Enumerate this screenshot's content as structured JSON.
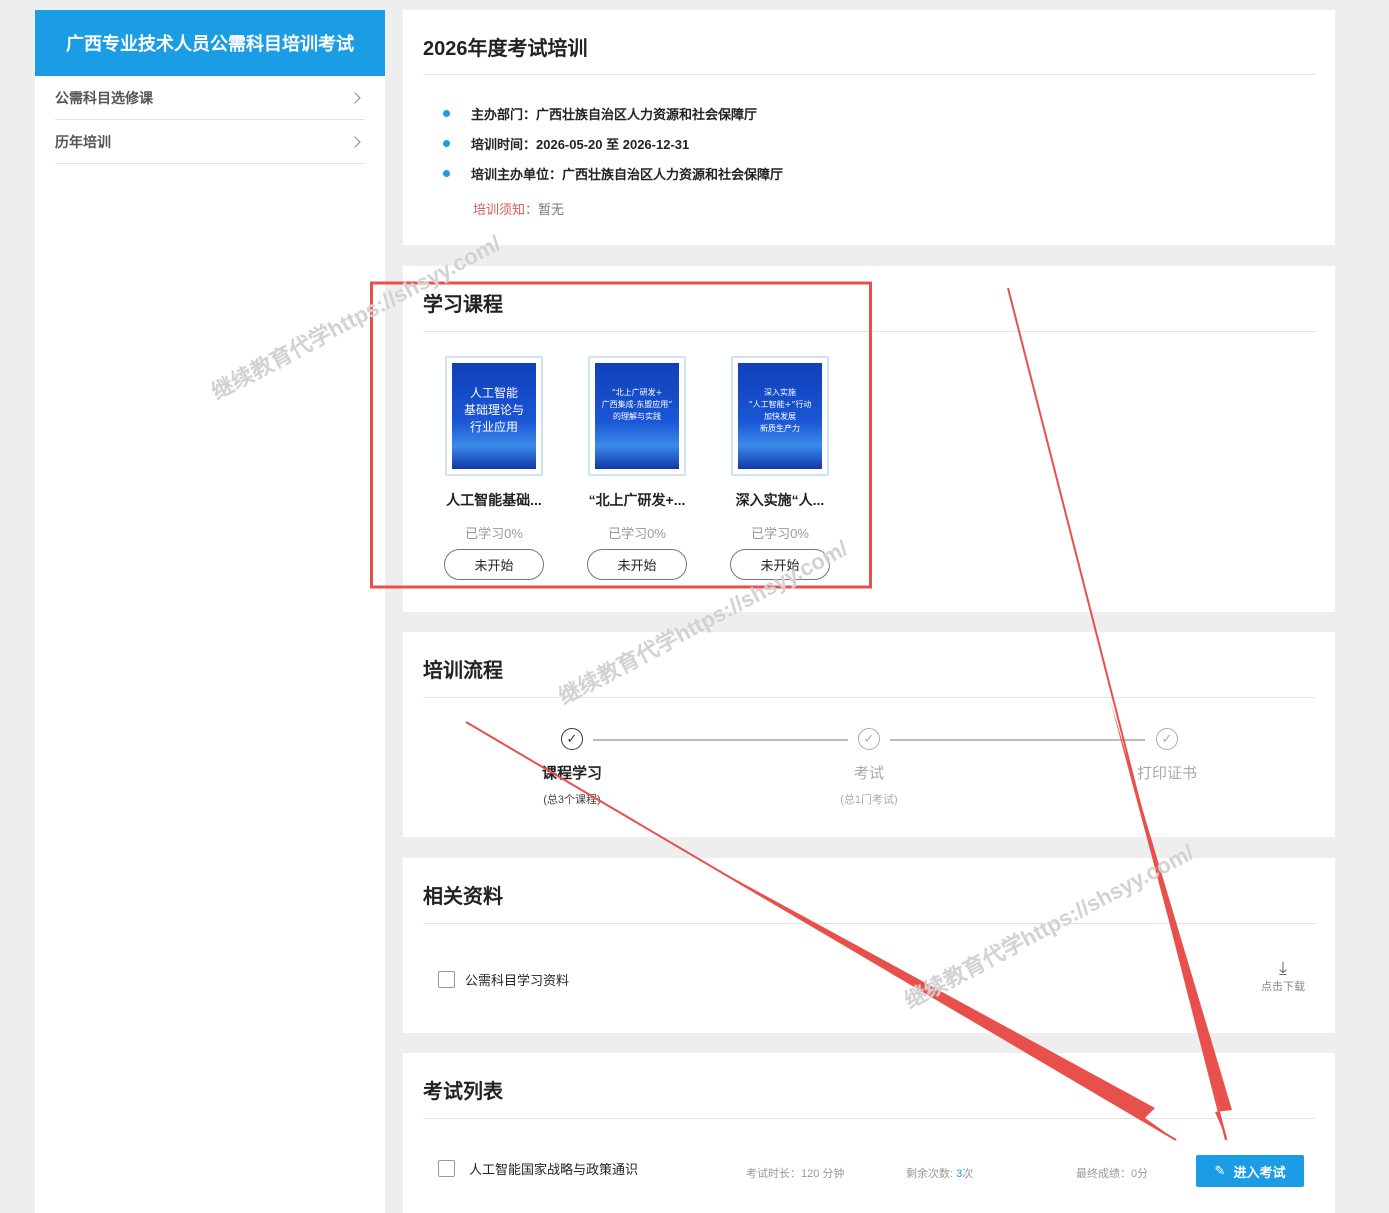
{
  "sidebar": {
    "title": "广西专业技术人员公需科目培训考试",
    "items": [
      {
        "label": "公需科目选修课"
      },
      {
        "label": "历年培训"
      }
    ]
  },
  "info": {
    "title": "2026年度考试培训",
    "rows": [
      {
        "label": "主办部门：",
        "value": "广西壮族自治区人力资源和社会保障厅"
      },
      {
        "label": "培训时间：",
        "value": "2026-05-20 至 2026-12-31"
      },
      {
        "label": "培训主办单位：",
        "value": "广西壮族自治区人力资源和社会保障厅"
      }
    ],
    "notice_label": "培训须知：",
    "notice_value": "暂无"
  },
  "courses": {
    "title": "学习课程",
    "items": [
      {
        "cover_text": "人工智能\n基础理论与\n行业应用",
        "name": "人工智能基础...",
        "progress": "已学习0%",
        "button": "未开始"
      },
      {
        "cover_text": "“北上广研发+\n广西集成-东盟应用”\n的理解与实践",
        "name": "“北上广研发+...",
        "progress": "已学习0%",
        "button": "未开始"
      },
      {
        "cover_text": "深入实施\n“人工智能+”行动\n加快发展\n新质生产力",
        "name": "深入实施“人...",
        "progress": "已学习0%",
        "button": "未开始"
      }
    ]
  },
  "process": {
    "title": "培训流程",
    "steps": [
      {
        "name": "课程学习",
        "sub": "(总3个课程)",
        "check": "✓"
      },
      {
        "name": "考试",
        "sub": "(总1门考试)",
        "check": "✓"
      },
      {
        "name": "打印证书",
        "sub": "",
        "check": "✓"
      }
    ]
  },
  "materials": {
    "title": "相关资料",
    "items": [
      {
        "name": "公需科目学习资料"
      }
    ],
    "download_label": "点击下载",
    "download_icon": "download-icon"
  },
  "exams": {
    "title": "考试列表",
    "items": [
      {
        "name": "人工智能国家战略与政策通识",
        "duration_label": "考试时长：",
        "duration_value": "120 分钟",
        "remaining_label": "剩余次数: ",
        "remaining_value": "3",
        "remaining_unit": "次",
        "score_label": "最终成绩：",
        "score_value": "0分",
        "button_icon": "✎",
        "button_label": "进入考试"
      }
    ]
  },
  "watermark": "继续教育代学https://shsyy.com/",
  "colors": {
    "accent": "#1b9de6",
    "annotation": "#e8504c",
    "notice_label": "#e05a4f"
  }
}
